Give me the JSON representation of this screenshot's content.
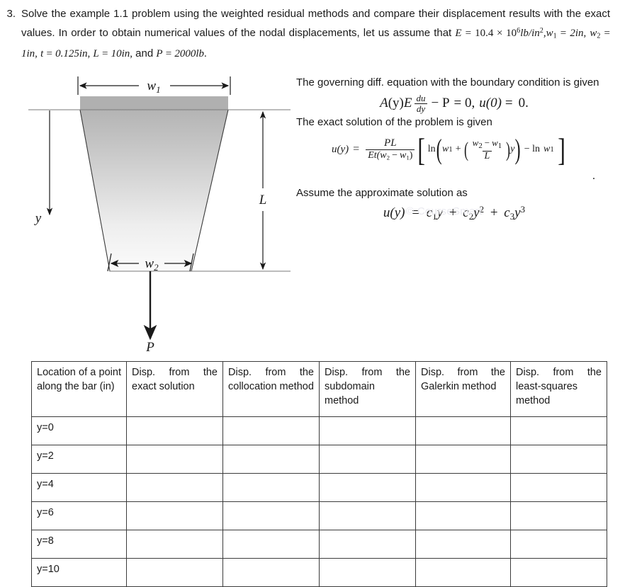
{
  "problem": {
    "number": "3.",
    "line1_a": "Solve the example 1.1 problem using the weighted residual methods and compare their displacement results with the exact values. In order to obtain numerical values of the nodal displacements, let us assume that ",
    "E_symbol": "E",
    "E_value": "10.4 × 10",
    "E_exp": "6",
    "E_unit": "lb/in",
    "E_unit_exp": "2",
    "w1_symbol": "w",
    "w1_sub": "1",
    "w1_value": "2in",
    "w2_symbol": "w",
    "w2_sub": "2",
    "w2_value": "1in",
    "t_symbol": "t",
    "t_value": "0.125in",
    "L_symbol": "L",
    "L_value": "10in",
    "and_text": "and ",
    "P_symbol": "P",
    "P_value": "2000lb",
    "period": "."
  },
  "figure": {
    "label_w1": "w",
    "label_w1_sub": "1",
    "label_w2": "w",
    "label_w2_sub": "2",
    "label_L": "L",
    "label_y": "y",
    "label_P": "P",
    "colors": {
      "cap_gray": "#b0b0b0",
      "body_top": "#b2b2b2",
      "body_bottom": "#fbfbfb",
      "stroke": "#333333",
      "thin_line": "#777777"
    }
  },
  "solution": {
    "intro_line": "The governing diff. equation with the boundary condition is given",
    "gov_eq": {
      "A": "A",
      "y_paren": "(y)",
      "E": "E",
      "du": "du",
      "dy": "dy",
      "minus_P": "− P",
      "equals_zero": "= 0,",
      "u0": "u(0)",
      "equals": "=",
      "zero": "0."
    },
    "exact_line": "The exact solution of the problem is given",
    "exact_eq": {
      "lhs": "u(y)",
      "eq": "=",
      "num": "PL",
      "den_Et": "Et(",
      "den_w2": "w",
      "den_w2_sub": "2",
      "den_minus": "−",
      "den_w1": "w",
      "den_w1_sub": "1",
      "den_close": ")",
      "bracket_open": "[",
      "ln": "ln",
      "paren_open": "(",
      "w1": "w",
      "w1_sub": "1",
      "plus": "+",
      "inner_paren_open": "(",
      "inner_num_w2": "w",
      "inner_num_w2_sub": "2",
      "inner_minus": "−",
      "inner_num_w1": "w",
      "inner_num_w1_sub": "1",
      "inner_den_L": "L",
      "inner_paren_close": ")",
      "y": "y",
      "paren_close": ")",
      "minus_ln": "− ln",
      "last_w1": "w",
      "last_w1_sub": "1",
      "bracket_close": "]",
      "trailing_period": "."
    },
    "watermark": "© CourseSmart",
    "assume_line": "Assume the approximate solution as",
    "approx_eq": {
      "lhs": "u(y)",
      "eq": "=",
      "t1_c": "c",
      "t1_sub": "1",
      "t1_y": "y",
      "plus1": "+",
      "t2_c": "c",
      "t2_sub": "2",
      "t2_y": "y",
      "t2_sup": "2",
      "plus2": "+",
      "t3_c": "c",
      "t3_sub": "3",
      "t3_y": "y",
      "t3_sup": "3"
    }
  },
  "table": {
    "headers": [
      "Location of a point along the bar (in)",
      "Disp. from the exact solution",
      "Disp. from the collocation method",
      "Disp. from the subdomain method",
      "Disp. from the Galerkin method",
      "Disp. from the least-squares method"
    ],
    "rows": [
      {
        "location": "y=0",
        "exact": "",
        "collocation": "",
        "subdomain": "",
        "galerkin": "",
        "least_squares": ""
      },
      {
        "location": "y=2",
        "exact": "",
        "collocation": "",
        "subdomain": "",
        "galerkin": "",
        "least_squares": ""
      },
      {
        "location": "y=4",
        "exact": "",
        "collocation": "",
        "subdomain": "",
        "galerkin": "",
        "least_squares": ""
      },
      {
        "location": "y=6",
        "exact": "",
        "collocation": "",
        "subdomain": "",
        "galerkin": "",
        "least_squares": ""
      },
      {
        "location": "y=8",
        "exact": "",
        "collocation": "",
        "subdomain": "",
        "galerkin": "",
        "least_squares": ""
      },
      {
        "location": "y=10",
        "exact": "",
        "collocation": "",
        "subdomain": "",
        "galerkin": "",
        "least_squares": ""
      }
    ]
  }
}
